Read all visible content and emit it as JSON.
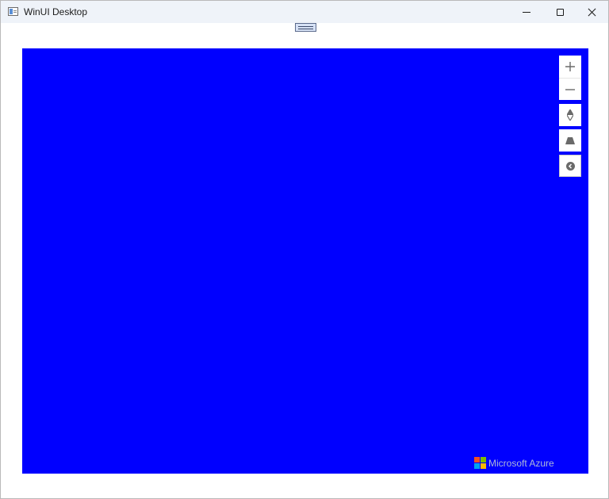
{
  "window": {
    "title": "WinUI Desktop"
  },
  "map": {
    "background_color": "#0000ff",
    "controls": {
      "zoom_in": "+",
      "zoom_out": "−",
      "icons": [
        "plus-icon",
        "minus-icon",
        "compass-icon",
        "pitch-icon",
        "chevron-left-icon"
      ]
    },
    "logo": {
      "text": "Microsoft Azure",
      "colors": [
        "#f25022",
        "#7fba00",
        "#00a4ef",
        "#ffb900"
      ]
    }
  }
}
